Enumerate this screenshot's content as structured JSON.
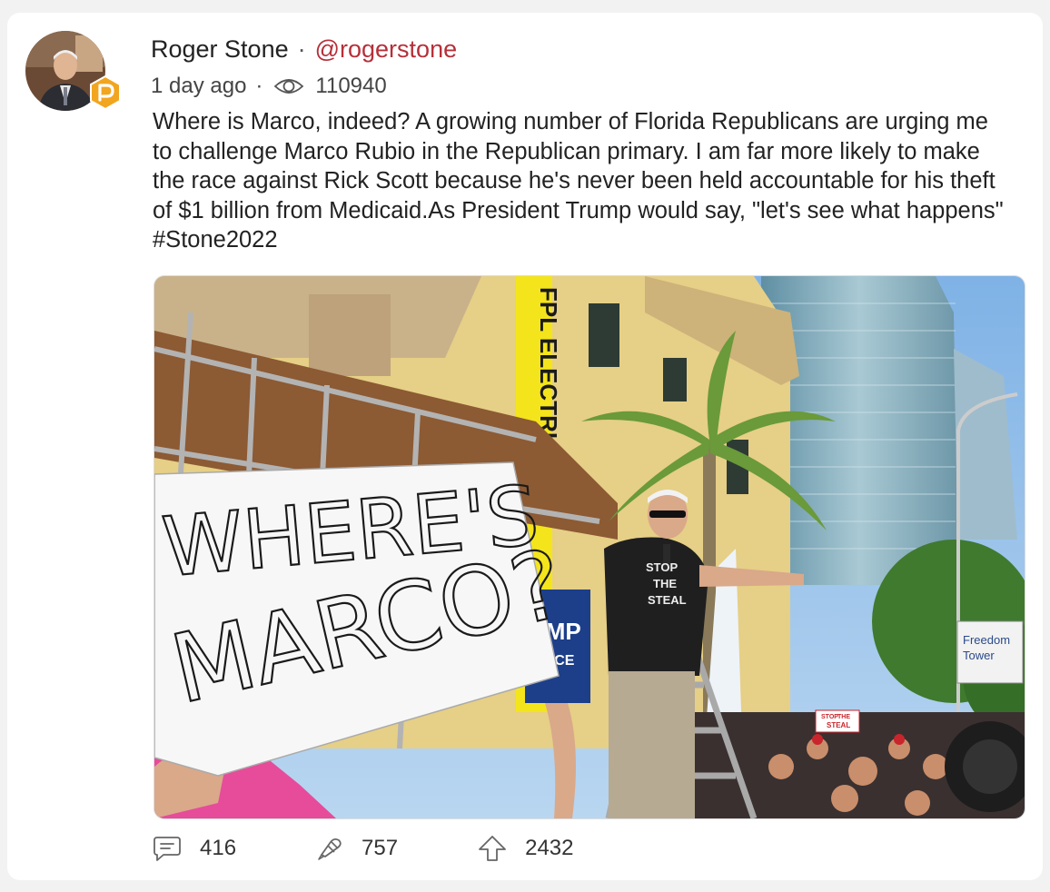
{
  "post": {
    "author_name": "Roger Stone",
    "separator": "·",
    "handle": "@rogerstone",
    "time_ago": "1 day ago",
    "views": "110940",
    "text": "Where is Marco, indeed? A growing number of Florida Republicans are urging me to challenge Marco Rubio in the Republican primary. I am far more likely to make the race against Rick Scott because he's never been held accountable for his theft of $1 billion from Medicaid.As President Trump would say, \"let's see what happens\" #Stone2022"
  },
  "media": {
    "sign_line1": "WHERE'S",
    "sign_line2": "MARCO?",
    "banner_text": "FPL ELECTRIC",
    "poster_text": "UMP",
    "poster_sub": "ENCE",
    "shirt_line1": "STOP",
    "shirt_line2": "THE",
    "shirt_line3": "STEAL",
    "freedom_sign_line1": "Freedom",
    "freedom_sign_line2": "Tower",
    "small_sign_line1": "STOP",
    "small_sign_line2": "THE",
    "small_sign_line3": "STEAL"
  },
  "actions": {
    "comments": "416",
    "echoes": "757",
    "upvotes": "2432"
  },
  "colors": {
    "handle": "#b5303a",
    "badge": "#f2a51f",
    "background": "#f2f2f2"
  },
  "icons": [
    "eye-icon",
    "comment-icon",
    "echo-icon",
    "upvote-icon",
    "parler-badge-icon"
  ]
}
